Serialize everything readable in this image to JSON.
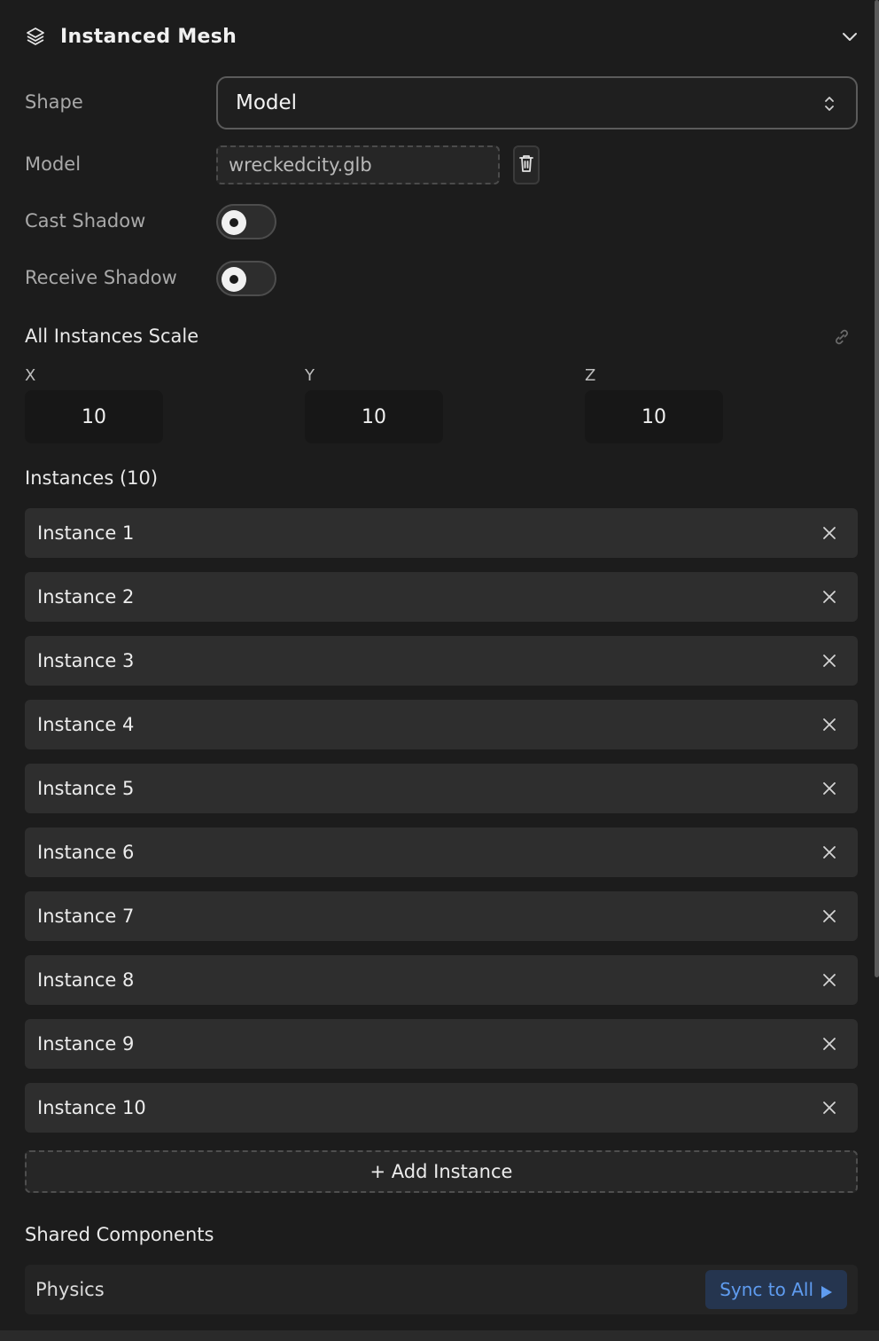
{
  "header": {
    "title": "Instanced Mesh",
    "icon": "layers-icon",
    "collapse_icon": "chevron-down-icon"
  },
  "shape": {
    "label": "Shape",
    "value": "Model"
  },
  "model": {
    "label": "Model",
    "file": "wreckedcity.glb"
  },
  "cast_shadow": {
    "label": "Cast Shadow",
    "enabled": false
  },
  "receive_shadow": {
    "label": "Receive Shadow",
    "enabled": false
  },
  "scale": {
    "title": "All Instances Scale",
    "x_label": "X",
    "x": "10",
    "y_label": "Y",
    "y": "10",
    "z_label": "Z",
    "z": "10"
  },
  "instances": {
    "title": "Instances (10)",
    "items": [
      "Instance 1",
      "Instance 2",
      "Instance 3",
      "Instance 4",
      "Instance 5",
      "Instance 6",
      "Instance 7",
      "Instance 8",
      "Instance 9",
      "Instance 10"
    ],
    "add_label": "+ Add Instance"
  },
  "shared": {
    "title": "Shared Components",
    "items": [
      {
        "name": "Physics",
        "action": "Sync to All"
      }
    ]
  },
  "colors": {
    "background": "#1c1c1c",
    "row": "#2e2e2e",
    "accent_text": "#5f9cf0",
    "accent_bg": "#25354f"
  }
}
